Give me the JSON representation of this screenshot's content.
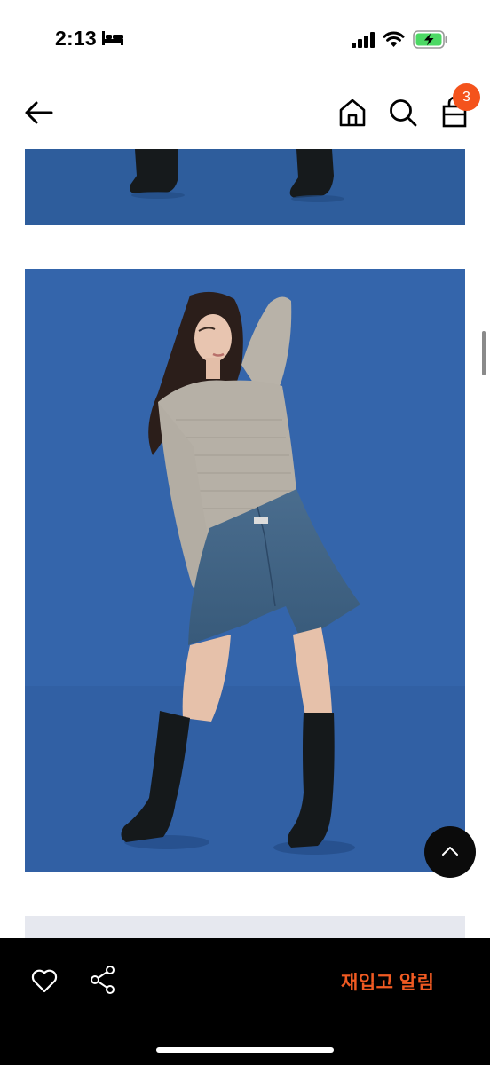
{
  "status_bar": {
    "time": "2:13",
    "icons": [
      "bed-icon",
      "cellular-signal-icon",
      "wifi-icon",
      "battery-charging-icon"
    ]
  },
  "nav": {
    "icons": [
      "back-arrow-icon",
      "home-icon",
      "search-icon",
      "shopping-bag-icon"
    ],
    "cart_count": "3"
  },
  "content": {
    "images": [
      "product-photo-boots-crop",
      "product-photo-model-full",
      "product-photo-next"
    ]
  },
  "scroll_top": {
    "icon": "chevron-up-icon"
  },
  "bottom_bar": {
    "icons": [
      "heart-icon",
      "share-icon"
    ],
    "restock_label": "재입고 알림"
  },
  "colors": {
    "accent": "#f05a22",
    "badge": "#f4531c",
    "photo_background": "#3566ad",
    "bottom_bar": "#000000"
  }
}
